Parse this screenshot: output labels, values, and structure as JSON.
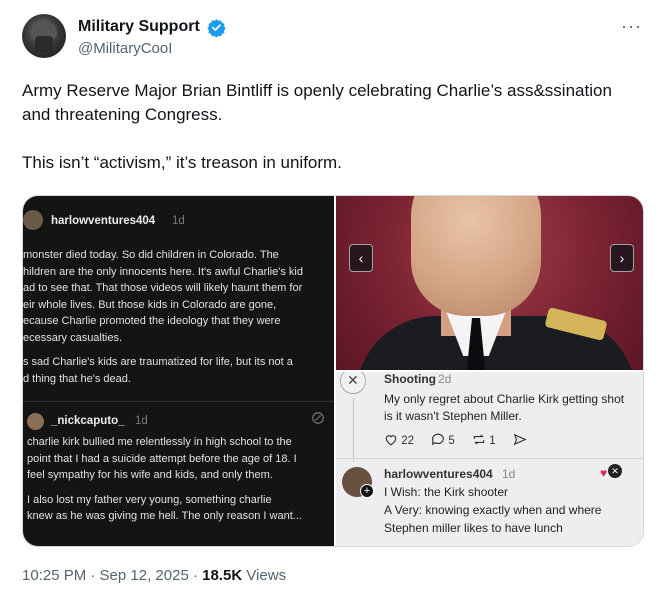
{
  "author": {
    "name": "Military Support",
    "handle": "@MilitaryCooI"
  },
  "more_glyph": "···",
  "tweet": {
    "paragraph1": "Army Reserve Major Brian Bintliff is openly celebrating Charlie’s ass&ssination and threatening Congress.",
    "paragraph2": "This isn’t “activism,” it’s treason in uniform."
  },
  "media": {
    "left": {
      "post1": {
        "user": "harlowventures404",
        "time": "1d",
        "lines": [
          "monster died today. So did children in Colorado. The",
          "hildren are the only innocents here. It's awful Charlie's kid",
          "ad to see that. That those videos will likely haunt them for",
          "eir whole lives. But those kids in Colorado are gone,",
          "ecause Charlie promoted the ideology that they were",
          "ecessary casualties.",
          "s sad Charlie's kids are traumatized for life, but its not a",
          "d thing that he's dead."
        ]
      },
      "post2": {
        "user": "_nickcaputo_",
        "time": "1d",
        "lines": [
          "charlie kirk bullied me relentlessly in high school to the",
          "point that I had a suicide attempt before the age of 18. I",
          "feel sympathy for his wife and kids, and only them.",
          "I also lost my father very young, something charlie",
          "knew as he was giving me hell. The only reason I want..."
        ]
      }
    },
    "nav": {
      "prev": "‹",
      "next": "›"
    },
    "right_bottom": {
      "post1": {
        "user": "Shooting",
        "time": "2d",
        "lines": [
          "My only regret about Charlie Kirk getting shot",
          "is it wasn't Stephen Miller."
        ],
        "likes": "22",
        "replies": "5",
        "reposts": "1"
      },
      "post2": {
        "user": "harlowventures404",
        "time": "1d",
        "lines": [
          "I Wish: the Kirk shooter",
          "A Very: knowing exactly when and where",
          "Stephen miller likes to have lunch"
        ]
      }
    }
  },
  "footer": {
    "timestamp": "10:25 PM · Sep 12, 2025",
    "separator": " · ",
    "views_count": "18.5K",
    "views_label": " Views"
  },
  "colors": {
    "verified_blue": "#1d9bf0",
    "muted_text": "#536471",
    "dark_panel": "#141414"
  }
}
